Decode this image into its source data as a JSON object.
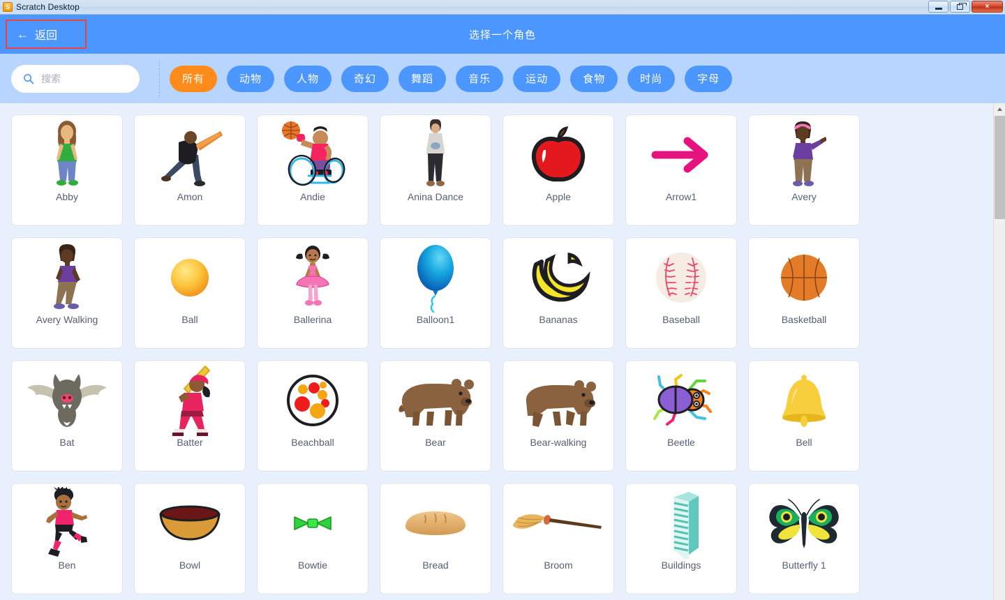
{
  "window": {
    "title": "Scratch Desktop",
    "icon": "scratch-cat-icon",
    "controls": {
      "minimize_label": "Minimize",
      "maximize_label": "Restore",
      "close_label": "×"
    }
  },
  "header": {
    "back_label": "返回",
    "back_arrow": "←",
    "title": "选择一个角色",
    "accent_color": "#4c97ff",
    "back_highlight_color": "#e8453c"
  },
  "search": {
    "placeholder": "搜索",
    "value": "",
    "icon": "search-icon"
  },
  "categories": [
    {
      "label": "所有",
      "active": true
    },
    {
      "label": "动物",
      "active": false
    },
    {
      "label": "人物",
      "active": false
    },
    {
      "label": "奇幻",
      "active": false
    },
    {
      "label": "舞蹈",
      "active": false
    },
    {
      "label": "音乐",
      "active": false
    },
    {
      "label": "运动",
      "active": false
    },
    {
      "label": "食物",
      "active": false
    },
    {
      "label": "时尚",
      "active": false
    },
    {
      "label": "字母",
      "active": false
    }
  ],
  "category_colors": {
    "active_background": "#ff8c1a",
    "inactive_background": "#4c97ff",
    "text": "#ffffff"
  },
  "sprites": [
    {
      "name": "Abby",
      "art": "girl-green-shirt"
    },
    {
      "name": "Amon",
      "art": "man-dancing"
    },
    {
      "name": "Andie",
      "art": "wheelchair-basketball"
    },
    {
      "name": "Anina Dance",
      "art": "person-photo-standing"
    },
    {
      "name": "Apple",
      "art": "apple"
    },
    {
      "name": "Arrow1",
      "art": "arrow-right"
    },
    {
      "name": "Avery",
      "art": "girl-purple-shirt"
    },
    {
      "name": "Avery Walking",
      "art": "girl-walking"
    },
    {
      "name": "Ball",
      "art": "ball-yellow"
    },
    {
      "name": "Ballerina",
      "art": "ballerina"
    },
    {
      "name": "Balloon1",
      "art": "balloon-blue"
    },
    {
      "name": "Bananas",
      "art": "bananas"
    },
    {
      "name": "Baseball",
      "art": "baseball"
    },
    {
      "name": "Basketball",
      "art": "basketball"
    },
    {
      "name": "Bat",
      "art": "bat"
    },
    {
      "name": "Batter",
      "art": "batter"
    },
    {
      "name": "Beachball",
      "art": "beachball"
    },
    {
      "name": "Bear",
      "art": "bear"
    },
    {
      "name": "Bear-walking",
      "art": "bear-walking"
    },
    {
      "name": "Beetle",
      "art": "beetle"
    },
    {
      "name": "Bell",
      "art": "bell"
    },
    {
      "name": "Ben",
      "art": "boy-kicking"
    },
    {
      "name": "Bowl",
      "art": "bowl"
    },
    {
      "name": "Bowtie",
      "art": "bowtie-green"
    },
    {
      "name": "Bread",
      "art": "bread"
    },
    {
      "name": "Broom",
      "art": "broom"
    },
    {
      "name": "Buildings",
      "art": "buildings"
    },
    {
      "name": "Butterfly 1",
      "art": "butterfly"
    }
  ],
  "scrollbar": {
    "up_arrow": "▲",
    "thumb_position_percent": 2
  }
}
